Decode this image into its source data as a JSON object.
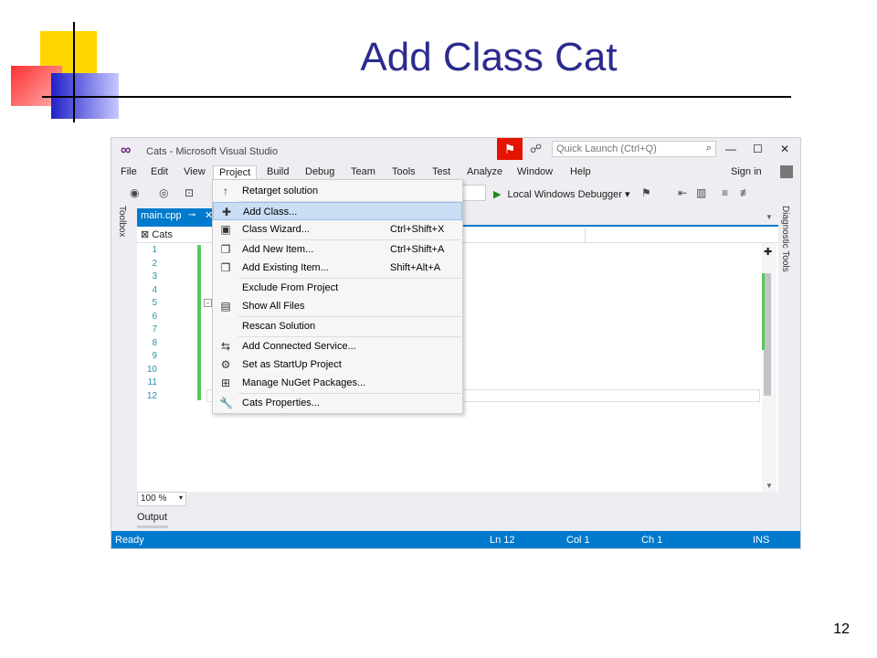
{
  "slide": {
    "title": "Add Class Cat",
    "page_number": "12"
  },
  "window": {
    "title": "Cats - Microsoft Visual Studio",
    "quick_launch_placeholder": "Quick Launch (Ctrl+Q)",
    "sign_in": "Sign in"
  },
  "menubar": [
    "File",
    "Edit",
    "View",
    "Project",
    "Build",
    "Debug",
    "Team",
    "Tools",
    "Test",
    "Analyze",
    "Window",
    "Help"
  ],
  "toolbar": {
    "debugger_label": "Local Windows Debugger"
  },
  "side_panels": {
    "toolbox": "Toolbox",
    "diagnostic": "Diagnostic Tools"
  },
  "editor": {
    "tab_label": "main.cpp",
    "scope": "Cats",
    "line_numbers": [
      "1",
      "2",
      "3",
      "4",
      "5",
      "6",
      "7",
      "8",
      "9",
      "10",
      "11",
      "12"
    ],
    "zoom": "100 %",
    "output_label": "Output"
  },
  "project_menu": [
    {
      "icon": "↑",
      "label": "Retarget solution",
      "shortcut": ""
    },
    {
      "icon": "✚",
      "label": "Add Class...",
      "shortcut": ""
    },
    {
      "icon": "▣",
      "label": "Class Wizard...",
      "shortcut": "Ctrl+Shift+X"
    },
    {
      "icon": "❐",
      "label": "Add New Item...",
      "shortcut": "Ctrl+Shift+A"
    },
    {
      "icon": "❐",
      "label": "Add Existing Item...",
      "shortcut": "Shift+Alt+A"
    },
    {
      "icon": "",
      "label": "Exclude From Project",
      "shortcut": ""
    },
    {
      "icon": "▤",
      "label": "Show All Files",
      "shortcut": ""
    },
    {
      "icon": "",
      "label": "Rescan Solution",
      "shortcut": ""
    },
    {
      "icon": "⇆",
      "label": "Add Connected Service...",
      "shortcut": ""
    },
    {
      "icon": "⚙",
      "label": "Set as StartUp Project",
      "shortcut": ""
    },
    {
      "icon": "⊞",
      "label": "Manage NuGet Packages...",
      "shortcut": ""
    },
    {
      "icon": "🔧",
      "label": "Cats Properties...",
      "shortcut": ""
    }
  ],
  "status": {
    "state": "Ready",
    "line": "Ln 12",
    "col": "Col 1",
    "ch": "Ch 1",
    "mode": "INS"
  },
  "colors": {
    "accent": "#007acc",
    "title": "#2b2b8f",
    "highlight": "#c9def5"
  }
}
